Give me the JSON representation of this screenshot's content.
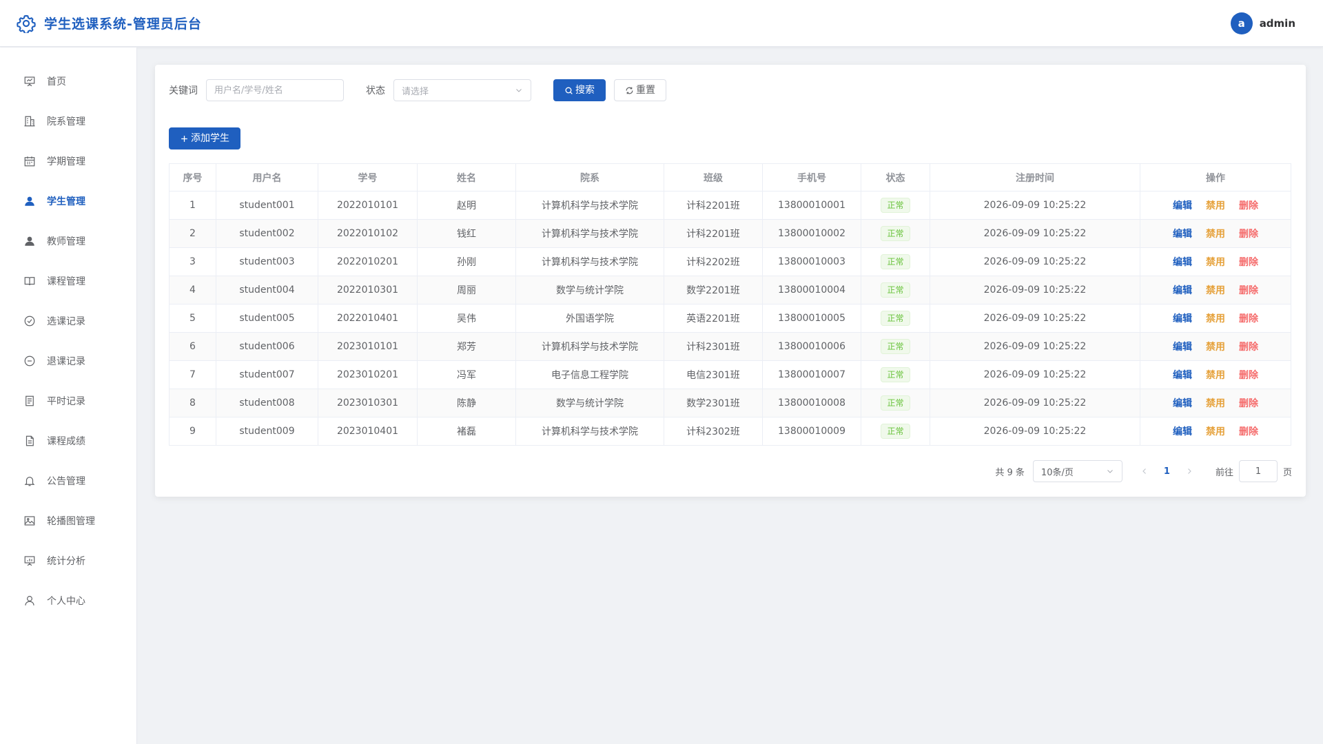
{
  "header": {
    "title": "学生选课系统-管理员后台",
    "logo_icon": "gear-icon",
    "user": {
      "avatar_letter": "a",
      "name": "admin"
    }
  },
  "sidebar": {
    "items": [
      {
        "label": "首页",
        "icon": "presentation-icon"
      },
      {
        "label": "院系管理",
        "icon": "building-icon"
      },
      {
        "label": "学期管理",
        "icon": "calendar-icon"
      },
      {
        "label": "学生管理",
        "icon": "user-filled-icon",
        "active": true
      },
      {
        "label": "教师管理",
        "icon": "user-filled-icon"
      },
      {
        "label": "课程管理",
        "icon": "book-icon"
      },
      {
        "label": "选课记录",
        "icon": "circle-check-icon"
      },
      {
        "label": "退课记录",
        "icon": "circle-minus-icon"
      },
      {
        "label": "平时记录",
        "icon": "tickets-icon"
      },
      {
        "label": "课程成绩",
        "icon": "document-icon"
      },
      {
        "label": "公告管理",
        "icon": "bell-icon"
      },
      {
        "label": "轮播图管理",
        "icon": "picture-icon"
      },
      {
        "label": "统计分析",
        "icon": "data-board-icon"
      },
      {
        "label": "个人中心",
        "icon": "user-icon"
      }
    ]
  },
  "filters": {
    "keyword_label": "关键词",
    "keyword_placeholder": "用户名/学号/姓名",
    "status_label": "状态",
    "status_placeholder": "请选择",
    "search_label": "搜索",
    "reset_label": "重置"
  },
  "add_button_label": "添加学生",
  "table": {
    "columns": [
      "序号",
      "用户名",
      "学号",
      "姓名",
      "院系",
      "班级",
      "手机号",
      "状态",
      "注册时间",
      "操作"
    ],
    "rows": [
      [
        "1",
        "student001",
        "2022010101",
        "赵明",
        "计算机科学与技术学院",
        "计科2201班",
        "13800010001",
        "正常",
        "2026-09-09 10:25:22"
      ],
      [
        "2",
        "student002",
        "2022010102",
        "钱红",
        "计算机科学与技术学院",
        "计科2201班",
        "13800010002",
        "正常",
        "2026-09-09 10:25:22"
      ],
      [
        "3",
        "student003",
        "2022010201",
        "孙刚",
        "计算机科学与技术学院",
        "计科2202班",
        "13800010003",
        "正常",
        "2026-09-09 10:25:22"
      ],
      [
        "4",
        "student004",
        "2022010301",
        "周丽",
        "数学与统计学院",
        "数学2201班",
        "13800010004",
        "正常",
        "2026-09-09 10:25:22"
      ],
      [
        "5",
        "student005",
        "2022010401",
        "吴伟",
        "外国语学院",
        "英语2201班",
        "13800010005",
        "正常",
        "2026-09-09 10:25:22"
      ],
      [
        "6",
        "student006",
        "2023010101",
        "郑芳",
        "计算机科学与技术学院",
        "计科2301班",
        "13800010006",
        "正常",
        "2026-09-09 10:25:22"
      ],
      [
        "7",
        "student007",
        "2023010201",
        "冯军",
        "电子信息工程学院",
        "电信2301班",
        "13800010007",
        "正常",
        "2026-09-09 10:25:22"
      ],
      [
        "8",
        "student008",
        "2023010301",
        "陈静",
        "数学与统计学院",
        "数学2301班",
        "13800010008",
        "正常",
        "2026-09-09 10:25:22"
      ],
      [
        "9",
        "student009",
        "2023010401",
        "褚磊",
        "计算机科学与技术学院",
        "计科2302班",
        "13800010009",
        "正常",
        "2026-09-09 10:25:22"
      ]
    ],
    "actions": [
      "编辑",
      "禁用",
      "删除"
    ]
  },
  "pagination": {
    "total_text": "共 9 条",
    "page_size": "10条/页",
    "current_page": "1",
    "goto_prefix": "前往",
    "goto_value": "1",
    "goto_suffix": "页"
  },
  "colors": {
    "primary": "#1f5fbf",
    "success": "#67c23a",
    "warning": "#e6a23c",
    "danger": "#f56c6c"
  }
}
